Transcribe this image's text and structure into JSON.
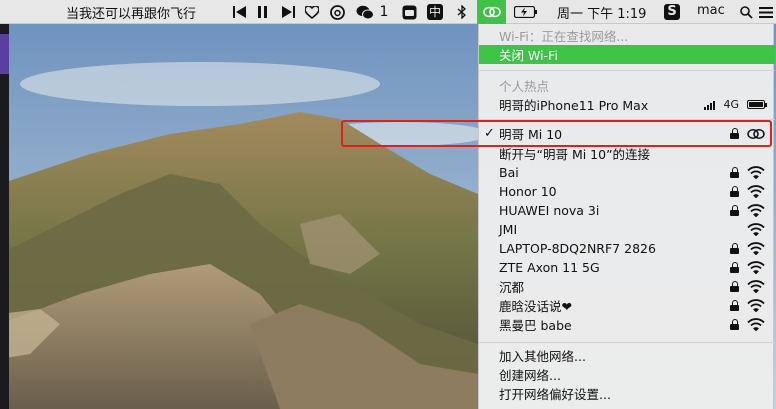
{
  "menubar": {
    "song": "当我还可以再跟你飞行",
    "datetime": "周一 下午 1:19",
    "user": "mac",
    "wechat_badge": "1",
    "input_method": "中",
    "battery_label": "",
    "colors": {
      "wifi_active": "#3fc248",
      "bar_bg": "#e7e7e7"
    }
  },
  "wifi_menu": {
    "status": "Wi-Fi：正在查找网络...",
    "turn_off": "关闭 Wi-Fi",
    "hotspot_header": "个人热点",
    "hotspot": {
      "name": "明哥的iPhone11 Pro Max",
      "network": "4G"
    },
    "connected": {
      "name": "明哥 Mi 10",
      "disconnect": "断开与“明哥 Mi 10”的连接"
    },
    "networks": [
      {
        "name": "Bai",
        "locked": true
      },
      {
        "name": "Honor 10",
        "locked": true
      },
      {
        "name": "HUAWEI nova 3i",
        "locked": true
      },
      {
        "name": "JMI",
        "locked": false
      },
      {
        "name": "LAPTOP-8DQ2NRF7 2826",
        "locked": true
      },
      {
        "name": "ZTE Axon 11 5G",
        "locked": true
      },
      {
        "name": "沉都",
        "locked": true
      },
      {
        "name": "鹿晗没话说❤",
        "locked": true
      },
      {
        "name": "黑曼巴 babe",
        "locked": true
      }
    ],
    "join_other": "加入其他网络...",
    "create": "创建网络...",
    "preferences": "打开网络偏好设置..."
  }
}
